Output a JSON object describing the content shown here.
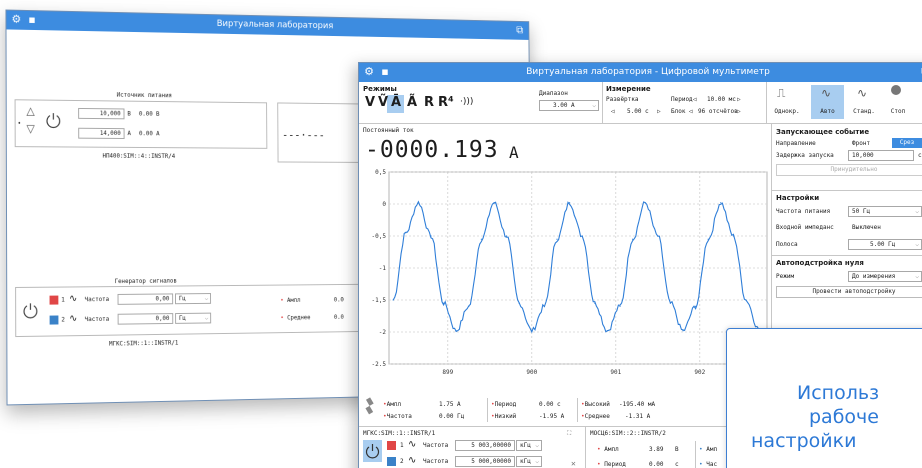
{
  "back_window": {
    "title": "Виртуальная лаборатория",
    "power_section": {
      "title": "Источник питания",
      "voltage_value": "10,000",
      "voltage_unit": "В",
      "voltage_reading": "0.00 В",
      "current_value": "14,000",
      "current_unit": "А",
      "current_reading": "0.00 А",
      "device_id": "НП400:SIM::4::INSTR/4"
    },
    "generator_section": {
      "title": "Генератор сигналов",
      "ch1_num": "1",
      "ch2_num": "2",
      "ch1_label": "Частота",
      "ch2_label": "Частота",
      "ch1_value": "0,00",
      "ch2_value": "0,00",
      "ch1_unit": "Гц",
      "ch2_unit": "Гц",
      "amp_label": "Ампл",
      "amp_value": "0.0",
      "avg_label": "Среднее",
      "avg_value": "0.0",
      "device_id": "МГКС:SIM::1::INSTR/1"
    },
    "dashes": "---·---"
  },
  "front_window": {
    "title": "Виртуальная лаборатория - Цифровой мультиметр",
    "modes": {
      "header": "Режимы",
      "buttons": [
        "V",
        "Ṽ",
        "Ā",
        "Ã",
        "R",
        "R⁴",
        "·)))"
      ],
      "range_label": "Диапазон",
      "range_value": "3.00 А"
    },
    "measurement": {
      "header": "Измерение",
      "sweep_label": "Развёртка",
      "sweep_value": "5.00 с",
      "period_label": "Период",
      "period_value": "10.00 мс",
      "block_label": "Блок",
      "block_value": "96 отсчётов"
    },
    "trigger_modes": {
      "buttons": [
        "Однокр.",
        "Авто",
        "Станд.",
        "Стоп"
      ],
      "active": "Авто"
    },
    "display": {
      "mode_label": "Постоянный ток",
      "value": "-0000.193",
      "unit": "А"
    },
    "start_event": {
      "header": "Запускающее событие",
      "direction_label": "Направление",
      "front_label": "Фронт",
      "cut_label": "Срез",
      "delay_label": "Задержка запуска",
      "delay_value": "10,000",
      "delay_unit": "с",
      "force_button": "Принудительно"
    },
    "settings": {
      "header": "Настройки",
      "freq_label": "Частота питания",
      "freq_value": "50 Гц",
      "impedance_label": "Входной импеданс",
      "impedance_value": "Выключен",
      "band_label": "Полоса",
      "band_value": "5.00 Гц"
    },
    "autozero": {
      "header": "Автоподстройка нуля",
      "mode_label": "Режим",
      "mode_value": "До измерения",
      "run_button": "Провести автоподстройку"
    },
    "stats": {
      "amp_label": "Ампл",
      "amp_value": "1.75 А",
      "freq_label": "Частота",
      "freq_value": "0.00 Гц",
      "period_label": "Период",
      "period_value": "0.00 с",
      "low_label": "Низкий",
      "low_value": "-1.95 А",
      "high_label": "Высокий",
      "high_value": "-195.40 мА",
      "avg_label": "Среднее",
      "avg_value": "-1.31 А"
    },
    "gen_panel": {
      "device_id": "МГКС:SIM::1::INSTR/1",
      "ch1_num": "1",
      "ch2_num": "2",
      "ch1_label": "Частота",
      "ch2_label": "Частота",
      "ch1_value": "5 003,00000",
      "ch2_value": "5 000,00000",
      "ch1_unit": "кГц",
      "ch2_unit": "кГц"
    },
    "osc_panel": {
      "device_id": "МОСЦ6:SIM::2::INSTR/2",
      "amp_label": "Ампл",
      "amp_value": "3.89",
      "amp_unit": "В",
      "period_label": "Период",
      "period_value": "0.00",
      "period_unit": "с",
      "right_amp": "Амп",
      "right_freq": "Час"
    }
  },
  "chart_data": {
    "type": "line",
    "title": "",
    "xlabel": "",
    "ylabel": "",
    "x_ticks": [
      "899",
      "900",
      "901",
      "902"
    ],
    "y_ticks": [
      "0,5",
      "0",
      "-0,5",
      "-1",
      "-1,5",
      "-2",
      "-2.5"
    ],
    "ylim": [
      -2.5,
      0.5
    ],
    "xlim": [
      898.3,
      902.8
    ],
    "grid": true,
    "series": [
      {
        "color": "#2f7ed8",
        "x": [
          898.35,
          898.5,
          898.65,
          898.8,
          898.95,
          899.1,
          899.25,
          899.4,
          899.55,
          899.7,
          899.85,
          900.0,
          900.15,
          900.3,
          900.45,
          900.6,
          900.75,
          900.9,
          901.05,
          901.2,
          901.35,
          901.5,
          901.65,
          901.8,
          901.95,
          902.1,
          902.25,
          902.4,
          902.55,
          902.7
        ],
        "y": [
          -1.5,
          -0.45,
          0.02,
          -0.5,
          -1.55,
          -1.98,
          -1.6,
          -0.55,
          0.02,
          -0.5,
          -1.55,
          -1.98,
          -1.6,
          -0.55,
          0.02,
          -0.5,
          -1.55,
          -1.98,
          -1.6,
          -0.55,
          0.02,
          -0.5,
          -1.55,
          -1.98,
          -1.6,
          -0.55,
          0.02,
          -0.5,
          -1.5,
          -1.95
        ]
      }
    ]
  },
  "overlay": {
    "line1": "Использ",
    "line2": "рабоче",
    "line3": "настройки"
  },
  "colors": {
    "accent": "#3d8ce0",
    "signal": "#2f7ed8",
    "channel1": "#e04646",
    "channel2": "#3a82c8",
    "overlay_text": "#2d79d6"
  }
}
